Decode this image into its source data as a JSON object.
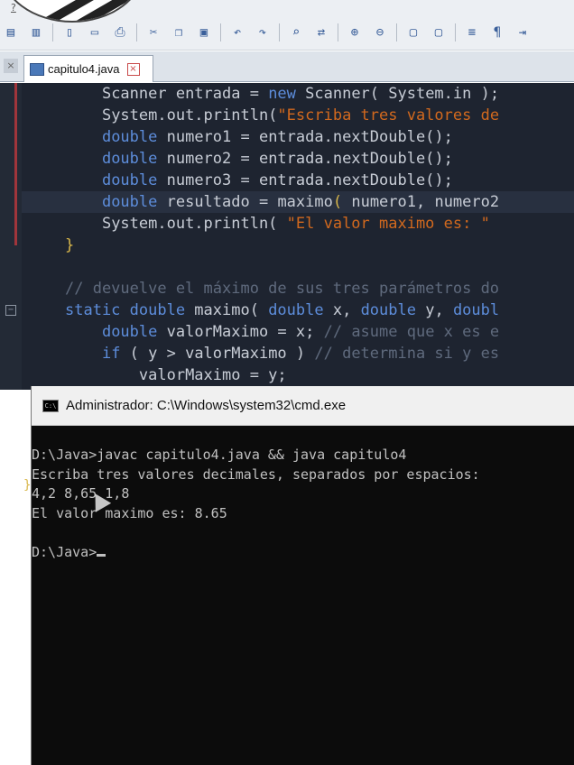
{
  "toolbar": {
    "help_label": "?",
    "buttons": [
      {
        "icon": "save-icon",
        "glyph": "▤"
      },
      {
        "icon": "save-all-icon",
        "glyph": "▥"
      },
      {
        "icon": "new-file-icon",
        "glyph": "▯"
      },
      {
        "icon": "close-file-icon",
        "glyph": "▭"
      },
      {
        "icon": "print-icon",
        "glyph": "⎙"
      },
      {
        "icon": "cut-icon",
        "glyph": "✂"
      },
      {
        "icon": "copy-icon",
        "glyph": "❐"
      },
      {
        "icon": "paste-icon",
        "glyph": "▣"
      },
      {
        "icon": "undo-icon",
        "glyph": "↶"
      },
      {
        "icon": "redo-icon",
        "glyph": "↷"
      },
      {
        "icon": "find-icon",
        "glyph": "⌕"
      },
      {
        "icon": "replace-icon",
        "glyph": "⇄"
      },
      {
        "icon": "zoom-in-icon",
        "glyph": "⊕"
      },
      {
        "icon": "zoom-out-icon",
        "glyph": "⊖"
      },
      {
        "icon": "window-icon",
        "glyph": "▢"
      },
      {
        "icon": "window2-icon",
        "glyph": "▢"
      },
      {
        "icon": "wrap-icon",
        "glyph": "≡"
      },
      {
        "icon": "pilcrow-icon",
        "glyph": "¶"
      },
      {
        "icon": "indent-icon",
        "glyph": "⇥"
      }
    ]
  },
  "tab": {
    "filename": "capitulo4.java"
  },
  "editor": {
    "lines": [
      {
        "indent": "    ",
        "parts": [
          [
            "fn",
            "Scanner entrada = "
          ],
          [
            "kw",
            "new"
          ],
          [
            "fn",
            " Scanner( System.in );"
          ]
        ]
      },
      {
        "indent": "    ",
        "parts": [
          [
            "fn",
            "System.out.println("
          ],
          [
            "str",
            "\"Escriba tres valores de"
          ]
        ]
      },
      {
        "indent": "    ",
        "parts": [
          [
            "kw",
            "double"
          ],
          [
            "fn",
            " numero1 = entrada.nextDouble();"
          ]
        ]
      },
      {
        "indent": "    ",
        "parts": [
          [
            "kw",
            "double"
          ],
          [
            "fn",
            " numero2 = entrada.nextDouble();"
          ]
        ]
      },
      {
        "indent": "    ",
        "parts": [
          [
            "kw",
            "double"
          ],
          [
            "fn",
            " numero3 = entrada.nextDouble();"
          ]
        ]
      },
      {
        "indent": "    ",
        "active": true,
        "parts": [
          [
            "kw",
            "double"
          ],
          [
            "fn",
            " resultado = "
          ],
          [
            "fn",
            "maximo"
          ],
          [
            "brace",
            "( "
          ],
          [
            "fn",
            "numero1, numero2"
          ]
        ]
      },
      {
        "indent": "    ",
        "parts": [
          [
            "fn",
            "System.out.println( "
          ],
          [
            "str",
            "\"El valor maximo es: \""
          ]
        ]
      },
      {
        "indent": "",
        "parts": [
          [
            "brace",
            "}"
          ]
        ]
      },
      {
        "indent": "",
        "parts": []
      },
      {
        "indent": "",
        "parts": [
          [
            "cm",
            "// devuelve el máximo de sus tres parámetros do"
          ]
        ]
      },
      {
        "indent": "",
        "parts": [
          [
            "kw",
            "static double"
          ],
          [
            "fn",
            " maximo( "
          ],
          [
            "kw",
            "double"
          ],
          [
            "fn",
            " x, "
          ],
          [
            "kw",
            "double"
          ],
          [
            "fn",
            " y, "
          ],
          [
            "kw",
            "doubl"
          ]
        ]
      },
      {
        "indent": "    ",
        "parts": [
          [
            "kw",
            "double"
          ],
          [
            "fn",
            " valorMaximo = x; "
          ],
          [
            "cm",
            "// asume que x es e"
          ]
        ]
      },
      {
        "indent": "    ",
        "parts": [
          [
            "kw",
            "if"
          ],
          [
            "fn",
            " ( y > valorMaximo ) "
          ],
          [
            "cm",
            "// determina si y es"
          ]
        ]
      },
      {
        "indent": "        ",
        "parts": [
          [
            "fn",
            "valorMaximo = y;"
          ]
        ]
      }
    ]
  },
  "cmd": {
    "title": "Administrador: C:\\Windows\\system32\\cmd.exe",
    "icon_text": "C:\\",
    "lines": [
      "D:\\Java>javac capitulo4.java && java capitulo4",
      "Escriba tres valores decimales, separados por espacios:",
      "4,2 8,65 1,8",
      "El valor maximo es: 8.65",
      "",
      "D:\\Java>"
    ]
  }
}
